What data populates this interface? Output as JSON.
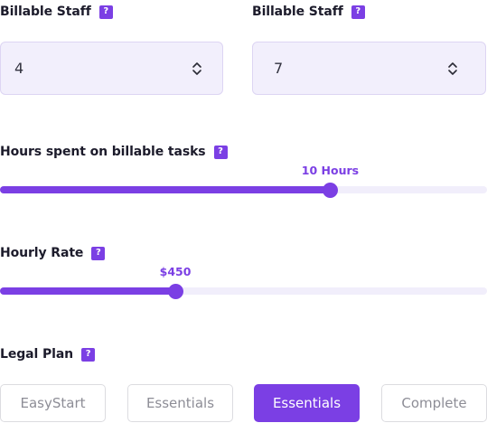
{
  "staff_left": {
    "label": "Billable Staff",
    "help": "?",
    "value": "4"
  },
  "staff_right": {
    "label": "Billable Staff",
    "help": "?",
    "value": "7"
  },
  "hours": {
    "label": "Hours spent on billable tasks",
    "help": "?",
    "value_text": "10 Hours",
    "fill_fraction": 0.678
  },
  "rate": {
    "label": "Hourly Rate",
    "help": "?",
    "value_text": "$450",
    "fill_fraction": 0.36
  },
  "plan": {
    "label": "Legal Plan",
    "help": "?",
    "options": [
      "EasyStart",
      "Essentials",
      "Essentials",
      "Complete"
    ],
    "selected_index": 2
  },
  "colors": {
    "accent": "#7b3fe4",
    "track": "#f1eefb",
    "select_bg": "#f2effc"
  },
  "icons": {
    "help": "question-mark-icon",
    "select": "chevron-up-down-icon"
  }
}
